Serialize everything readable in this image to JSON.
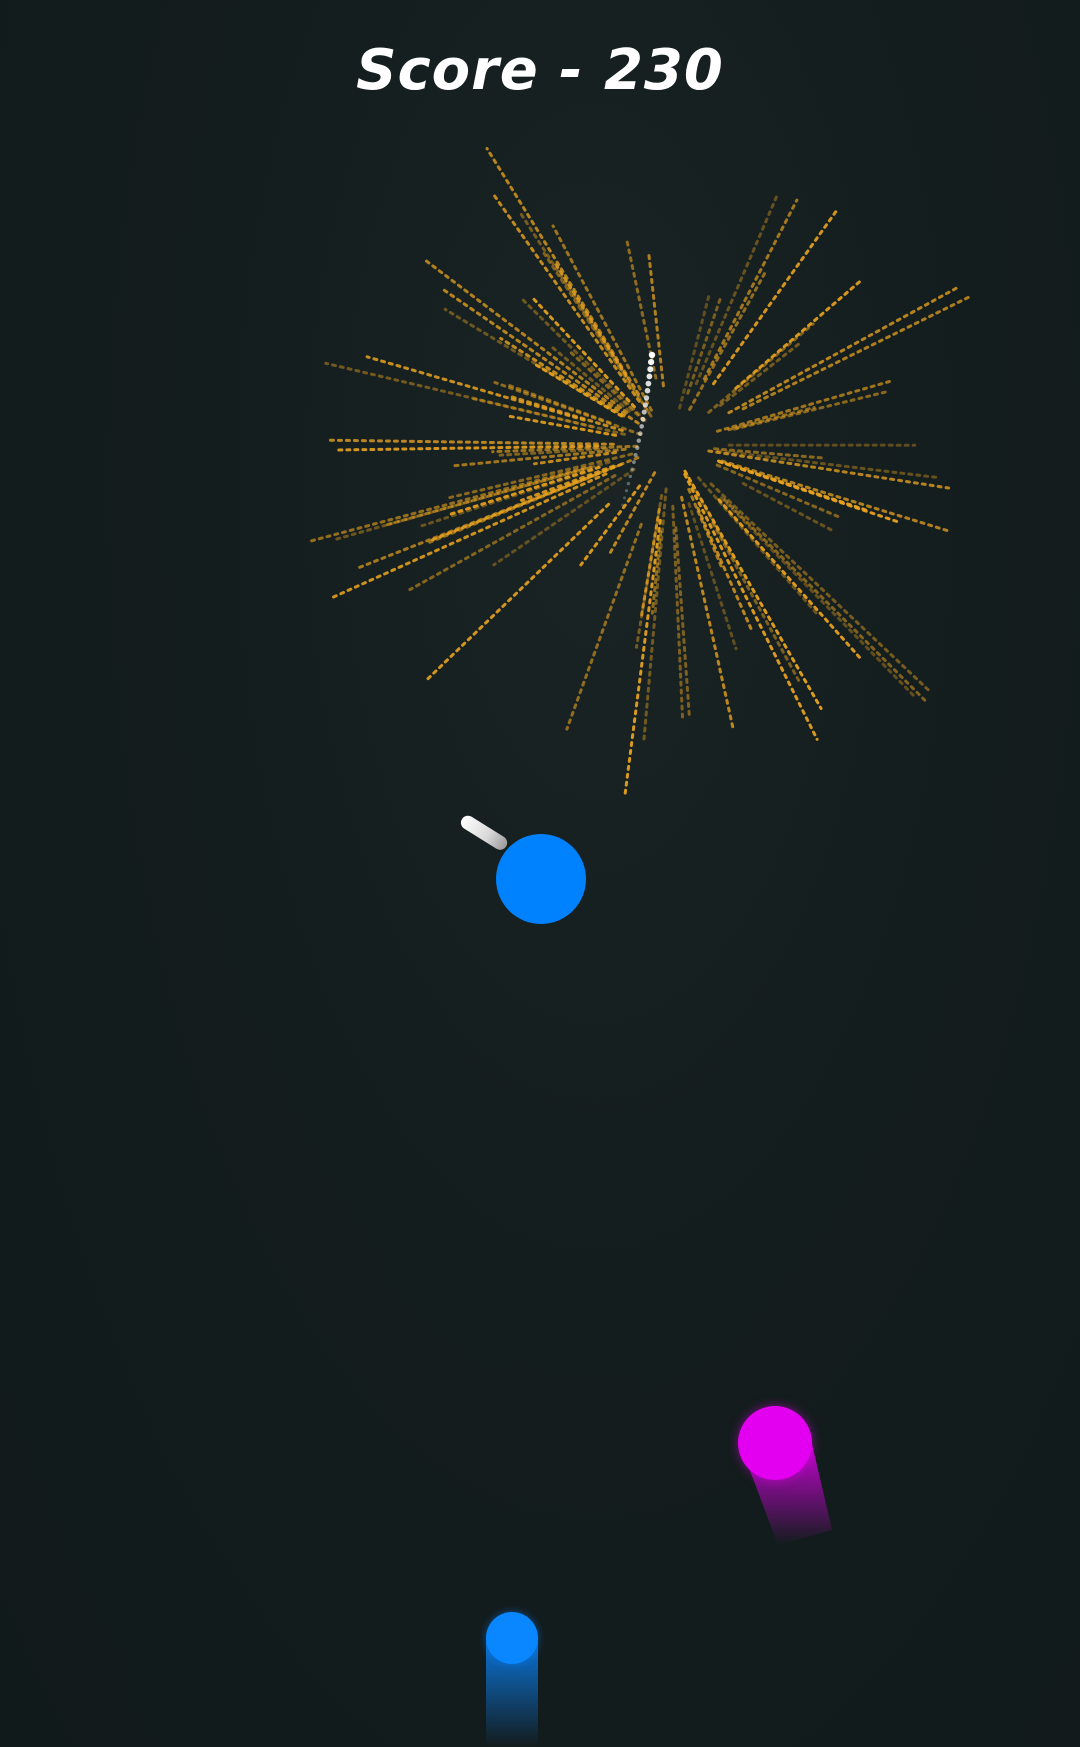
{
  "hud": {
    "score_text": "Score - 230"
  },
  "colors": {
    "background": "#131c1d",
    "player_ball": "#0082ff",
    "magenta_ball": "#e300f0",
    "small_blue_ball": "#0a86ff",
    "firework": "#e8a21e",
    "score_text": "#ffffff"
  },
  "icons": {
    "cannon": "cannon-icon",
    "firework": "firework-burst"
  }
}
